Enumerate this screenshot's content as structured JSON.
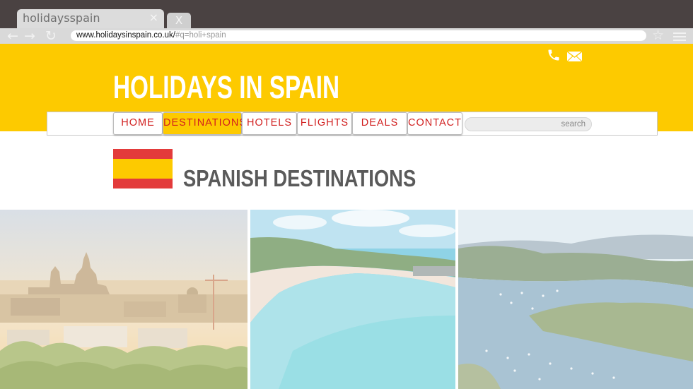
{
  "browser": {
    "tab_title": "holidaysspain",
    "tab_close": "×",
    "new_tab": "X",
    "url_main": "www.holidaysinspain.co.uk/",
    "url_fragment": "#q=holi+spain",
    "icons": [
      "back-arrow-icon",
      "forward-arrow-icon",
      "reload-icon",
      "star-icon",
      "menu-icon"
    ]
  },
  "header": {
    "title": "HOLIDAYS IN SPAIN",
    "icons": [
      "phone-icon",
      "mail-icon"
    ],
    "colors": {
      "brand_yellow": "#fdca00",
      "nav_red": "#d11f1f"
    }
  },
  "nav": {
    "items": [
      {
        "label": "HOME",
        "active": false
      },
      {
        "label": "DESTINATIONS",
        "active": true
      },
      {
        "label": "HOTELS",
        "active": false
      },
      {
        "label": "FLIGHTS",
        "active": false
      },
      {
        "label": "DEALS",
        "active": false
      },
      {
        "label": "CONTACT",
        "active": false
      }
    ],
    "search_placeholder": "search"
  },
  "content": {
    "section_title": "SPANISH DESTINATIONS",
    "flag": "spain-flag",
    "photos": [
      "madrid-cityscape",
      "beach-turquoise-water",
      "coastal-bay-boats"
    ]
  }
}
